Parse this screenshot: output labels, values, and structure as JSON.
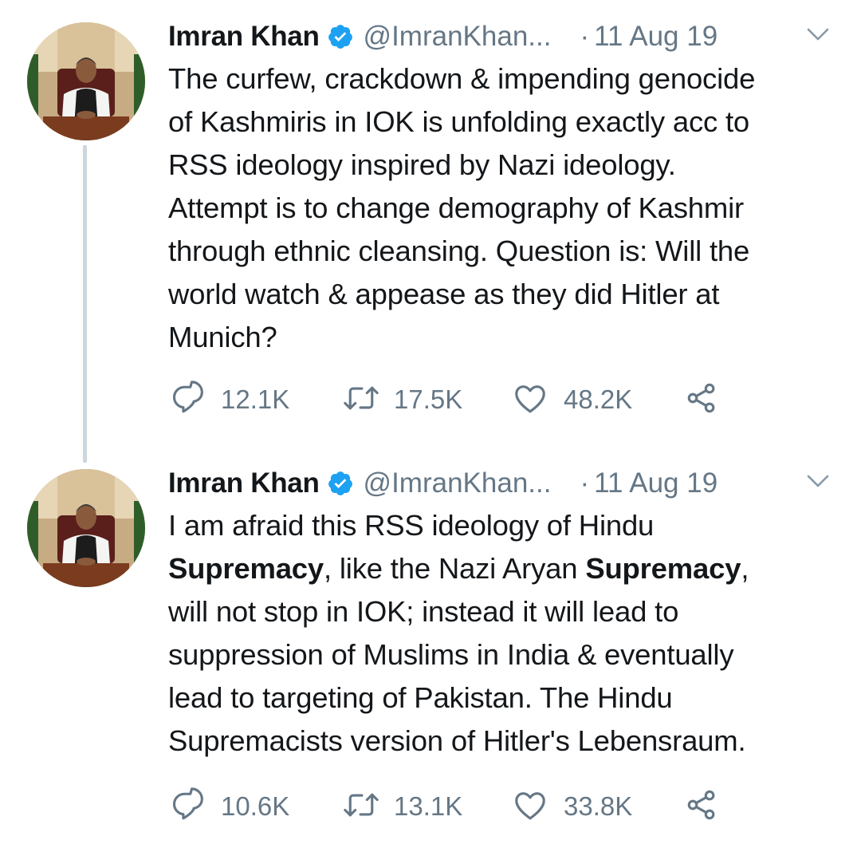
{
  "colors": {
    "text": "#14171a",
    "secondary": "#657786",
    "verified": "#1da1f2",
    "thread_line": "#ccd6dd"
  },
  "tweets": [
    {
      "author_name": "Imran Khan",
      "handle": "@ImranKhan...",
      "separator": "·",
      "date": "11 Aug 19",
      "lines": [
        "The curfew, crackdown & impending genocide",
        "of Kashmiris in IOK is unfolding exactly acc to",
        "RSS ideology inspired by Nazi ideology.",
        "Attempt is to change demography of Kashmir",
        "through ethnic cleansing. Question is: Will the",
        "world watch & appease as they did Hitler at",
        "Munich?"
      ],
      "replies": "12.1K",
      "retweets": "17.5K",
      "likes": "48.2K",
      "icons": [
        "verified-badge-icon",
        "chevron-down-icon",
        "reply-icon",
        "retweet-icon",
        "like-icon",
        "share-icon"
      ]
    },
    {
      "author_name": "Imran Khan",
      "handle": "@ImranKhan...",
      "separator": "·",
      "date": "11 Aug 19",
      "lines": [
        "I am afraid this RSS ideology of Hindu",
        "Supremacy",
        ", like the Nazi Aryan ",
        "Supremacy",
        ",",
        "will not stop in IOK; instead it will lead to",
        "suppression of Muslims in India & eventually",
        "lead to targeting of Pakistan. The Hindu",
        "Supremacists version of Hitler's Lebensraum."
      ],
      "replies": "10.6K",
      "retweets": "13.1K",
      "likes": "33.8K",
      "icons": [
        "verified-badge-icon",
        "chevron-down-icon",
        "reply-icon",
        "retweet-icon",
        "like-icon",
        "share-icon"
      ]
    }
  ]
}
